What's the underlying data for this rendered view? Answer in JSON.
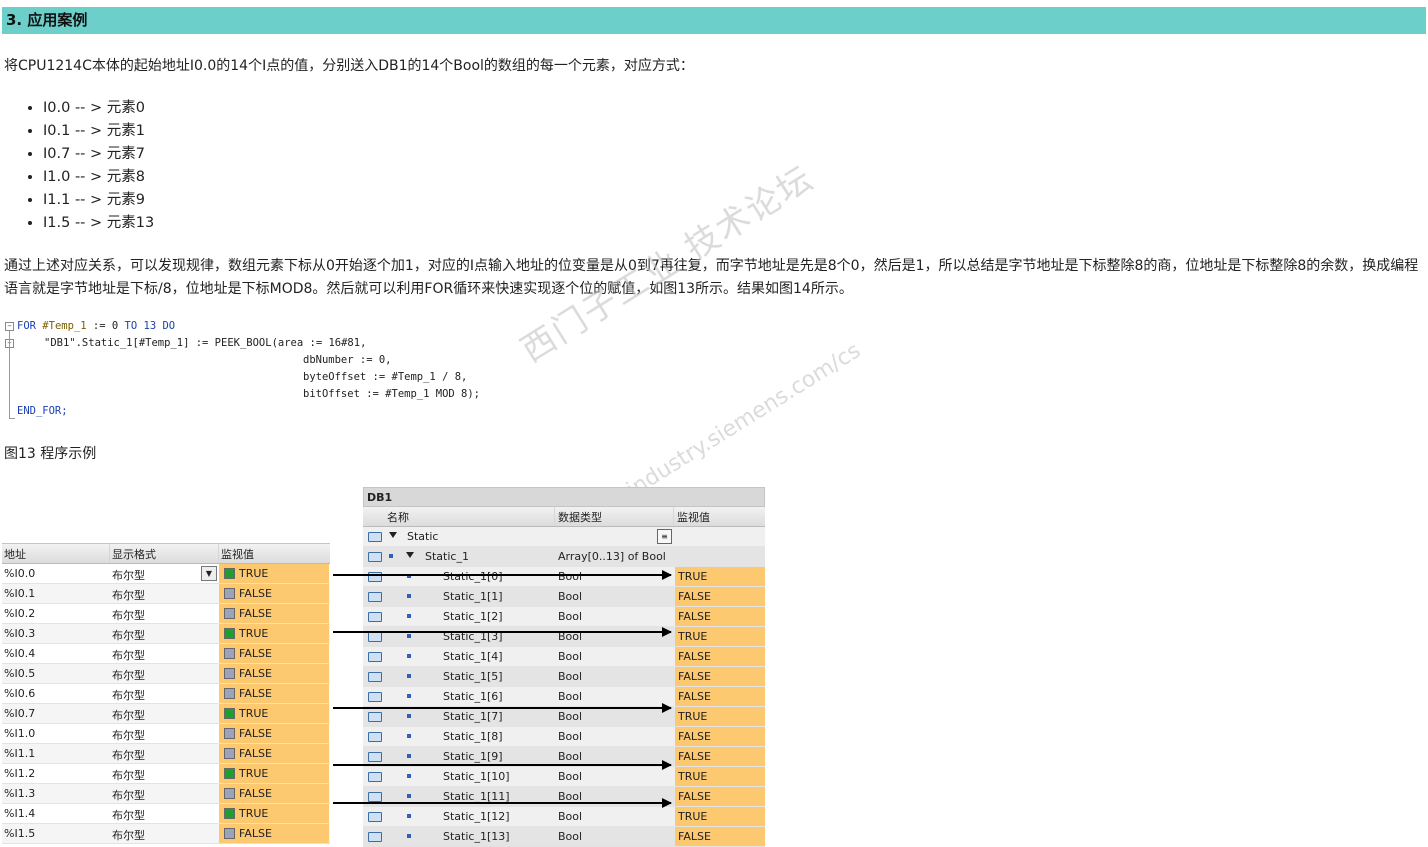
{
  "section": {
    "title": "3. 应用案例"
  },
  "intro": "将CPU1214C本体的起始地址I0.0的14个I点的值，分别送入DB1的14个Bool的数组的每一个元素，对应方式：",
  "mapping": [
    "I0.0 -- > 元素0",
    "I0.1 -- > 元素1",
    "I0.7 -- > 元素7",
    "I1.0 -- > 元素8",
    "I1.1 -- > 元素9",
    "I1.5 -- > 元素13"
  ],
  "explanation": "通过上述对应关系，可以发现规律，数组元素下标从0开始逐个加1，对应的I点输入地址的位变量是从0到7再往复，而字节地址是先是8个0，然后是1，所以总结是字节地址是下标整除8的商，位地址是下标整除8的余数，换成编程语言就是字节地址是下标/8，位地址是下标MOD8。然后就可以利用FOR循环来快速实现逐个位的赋值，如图13所示。结果如图14所示。",
  "code": {
    "l1_for": "FOR",
    "l1_var": "#Temp_1",
    "l1_assign": ":= 0",
    "l1_to": "TO",
    "l1_end": "13",
    "l1_do": "DO",
    "l2": "\"DB1\".Static_1[#Temp_1] := PEEK_BOOL(area := 16#81,",
    "l3": "dbNumber := 0,",
    "l4": "byteOffset := #Temp_1 / 8,",
    "l5": "bitOffset := #Temp_1 MOD 8);",
    "l6": "END_FOR;"
  },
  "caption": "图13 程序示例",
  "watermark": {
    "line1": "西门子工业 技术论坛",
    "line2": "support.industry.siemens.com/cs"
  },
  "watch_table": {
    "headers": {
      "address": "地址",
      "format": "显示格式",
      "value": "监视值"
    },
    "rows": [
      {
        "address": "%I0.0",
        "format": "布尔型",
        "value": "TRUE"
      },
      {
        "address": "%I0.1",
        "format": "布尔型",
        "value": "FALSE"
      },
      {
        "address": "%I0.2",
        "format": "布尔型",
        "value": "FALSE"
      },
      {
        "address": "%I0.3",
        "format": "布尔型",
        "value": "TRUE"
      },
      {
        "address": "%I0.4",
        "format": "布尔型",
        "value": "FALSE"
      },
      {
        "address": "%I0.5",
        "format": "布尔型",
        "value": "FALSE"
      },
      {
        "address": "%I0.6",
        "format": "布尔型",
        "value": "FALSE"
      },
      {
        "address": "%I0.7",
        "format": "布尔型",
        "value": "TRUE"
      },
      {
        "address": "%I1.0",
        "format": "布尔型",
        "value": "FALSE"
      },
      {
        "address": "%I1.1",
        "format": "布尔型",
        "value": "FALSE"
      },
      {
        "address": "%I1.2",
        "format": "布尔型",
        "value": "TRUE"
      },
      {
        "address": "%I1.3",
        "format": "布尔型",
        "value": "FALSE"
      },
      {
        "address": "%I1.4",
        "format": "布尔型",
        "value": "TRUE"
      },
      {
        "address": "%I1.5",
        "format": "布尔型",
        "value": "FALSE"
      }
    ]
  },
  "db_table": {
    "title": "DB1",
    "headers": {
      "name": "名称",
      "type": "数据类型",
      "value": "监视值"
    },
    "static_label": "Static",
    "array": {
      "name": "Static_1",
      "type": "Array[0..13] of Bool"
    },
    "rows": [
      {
        "name": "Static_1[0]",
        "type": "Bool",
        "value": "TRUE"
      },
      {
        "name": "Static_1[1]",
        "type": "Bool",
        "value": "FALSE"
      },
      {
        "name": "Static_1[2]",
        "type": "Bool",
        "value": "FALSE"
      },
      {
        "name": "Static_1[3]",
        "type": "Bool",
        "value": "TRUE"
      },
      {
        "name": "Static_1[4]",
        "type": "Bool",
        "value": "FALSE"
      },
      {
        "name": "Static_1[5]",
        "type": "Bool",
        "value": "FALSE"
      },
      {
        "name": "Static_1[6]",
        "type": "Bool",
        "value": "FALSE"
      },
      {
        "name": "Static_1[7]",
        "type": "Bool",
        "value": "TRUE"
      },
      {
        "name": "Static_1[8]",
        "type": "Bool",
        "value": "FALSE"
      },
      {
        "name": "Static_1[9]",
        "type": "Bool",
        "value": "FALSE"
      },
      {
        "name": "Static_1[10]",
        "type": "Bool",
        "value": "TRUE"
      },
      {
        "name": "Static_1[11]",
        "type": "Bool",
        "value": "FALSE"
      },
      {
        "name": "Static_1[12]",
        "type": "Bool",
        "value": "TRUE"
      },
      {
        "name": "Static_1[13]",
        "type": "Bool",
        "value": "FALSE"
      }
    ]
  },
  "colors": {
    "section_bar": "#6ccfca",
    "value_cell": "#fcc870",
    "true_box": "#1f9e2e",
    "false_box": "#9ca3b9"
  }
}
